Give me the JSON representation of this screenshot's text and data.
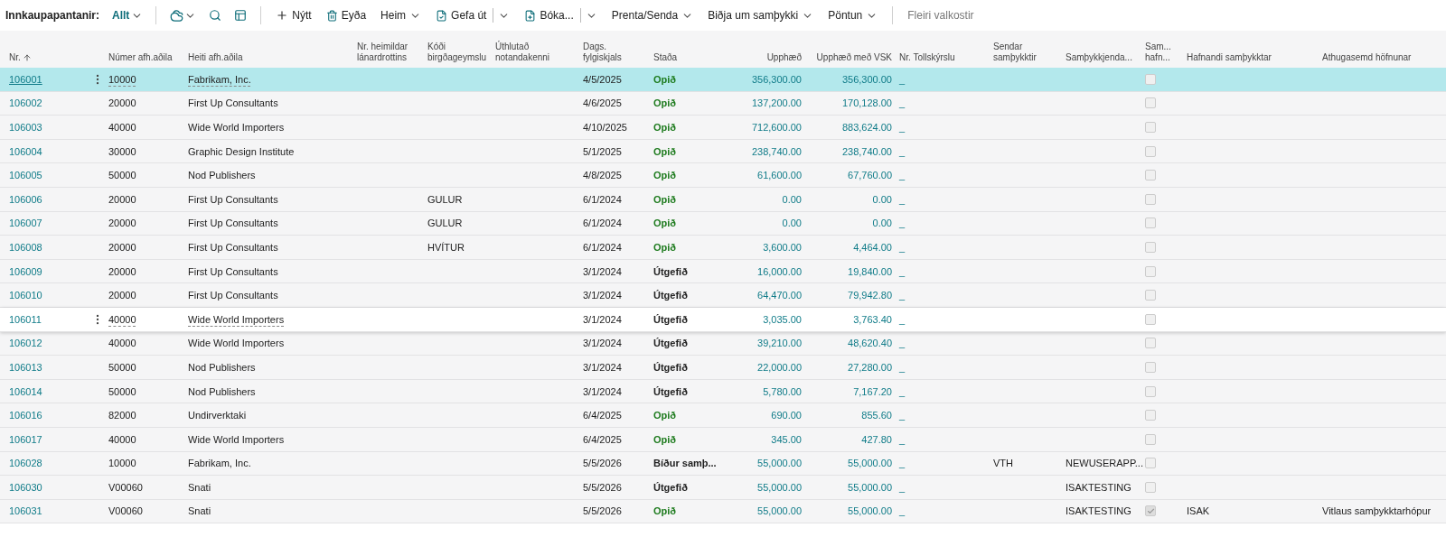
{
  "toolbar": {
    "title": "Innkaupapantanir:",
    "view": {
      "label": "Allt"
    },
    "icon_buttons": [
      {
        "kind": "share",
        "menu": true
      },
      {
        "kind": "search",
        "menu": false
      },
      {
        "kind": "layout",
        "menu": false
      }
    ],
    "actions": [
      {
        "label": "Nýtt",
        "kind": "add"
      },
      {
        "label": "Eyða",
        "kind": "delete"
      },
      {
        "label": "Heim",
        "kind": "menu"
      },
      {
        "label": "Gefa út",
        "kind": "release"
      },
      {
        "label": "Bóka...",
        "kind": "post"
      },
      {
        "label": "Prenta/Senda",
        "kind": "menu"
      },
      {
        "label": "Biðja um samþykki",
        "kind": "menu"
      },
      {
        "label": "Pöntun",
        "kind": "menu"
      }
    ],
    "more": "Fleiri valkostir"
  },
  "table": {
    "columns": [
      {
        "label": "Nr.",
        "sorted_ascending": true
      },
      {
        "label": "Númer afh.aðila"
      },
      {
        "label": "Heiti afh.aðila"
      },
      {
        "label": "Nr. heimildar\nlánardrottins"
      },
      {
        "label": "Kóði\nbirgðageymslu"
      },
      {
        "label": "Úthlutað\nnotandakenni"
      },
      {
        "label": "Dags.\nfylgiskjals"
      },
      {
        "label": "Staða"
      },
      {
        "label": "Upphæð"
      },
      {
        "label": "Upphæð með VSK"
      },
      {
        "label": "Nr. Tollskýrslu"
      },
      {
        "label": "Sendar\nsamþykktir"
      },
      {
        "label": "Samþykkjenda..."
      },
      {
        "label": "Sam...\nhafn..."
      },
      {
        "label": "Hafnandi samþykktar"
      },
      {
        "label": "Athugasemd höfnunar"
      }
    ],
    "rows": [
      {
        "no": "106001",
        "vendor_no": "10000",
        "vendor": "Fabrikam, Inc.",
        "date": "4/5/2025",
        "status": "Opið",
        "color": "#1e7b1e",
        "amount": "356,300.00",
        "amount_vat": "356,300.00",
        "customs": "_",
        "rejected": false,
        "selected": true,
        "focused": false
      },
      {
        "no": "106002",
        "vendor_no": "20000",
        "vendor": "First Up Consultants",
        "date": "4/6/2025",
        "status": "Opið",
        "color": "#1e7b1e",
        "amount": "137,200.00",
        "amount_vat": "170,128.00",
        "customs": "_",
        "rejected": false,
        "selected": false,
        "focused": false
      },
      {
        "no": "106003",
        "vendor_no": "40000",
        "vendor": "Wide World Importers",
        "date": "4/10/2025",
        "status": "Opið",
        "color": "#1e7b1e",
        "amount": "712,600.00",
        "amount_vat": "883,624.00",
        "customs": "_",
        "rejected": false,
        "selected": false,
        "focused": false
      },
      {
        "no": "106004",
        "vendor_no": "30000",
        "vendor": "Graphic Design Institute",
        "date": "5/1/2025",
        "status": "Opið",
        "color": "#1e7b1e",
        "amount": "238,740.00",
        "amount_vat": "238,740.00",
        "customs": "_",
        "rejected": false,
        "selected": false,
        "focused": false
      },
      {
        "no": "106005",
        "vendor_no": "50000",
        "vendor": "Nod Publishers",
        "date": "4/8/2025",
        "status": "Opið",
        "color": "#1e7b1e",
        "amount": "61,600.00",
        "amount_vat": "67,760.00",
        "customs": "_",
        "rejected": false,
        "selected": false,
        "focused": false
      },
      {
        "no": "106006",
        "vendor_no": "20000",
        "vendor": "First Up Consultants",
        "location": "GULUR",
        "date": "6/1/2024",
        "status": "Opið",
        "color": "#1e7b1e",
        "amount": "0.00",
        "amount_vat": "0.00",
        "customs": "_",
        "rejected": false,
        "selected": false,
        "focused": false
      },
      {
        "no": "106007",
        "vendor_no": "20000",
        "vendor": "First Up Consultants",
        "location": "GULUR",
        "date": "6/1/2024",
        "status": "Opið",
        "color": "#1e7b1e",
        "amount": "0.00",
        "amount_vat": "0.00",
        "customs": "_",
        "rejected": false,
        "selected": false,
        "focused": false
      },
      {
        "no": "106008",
        "vendor_no": "20000",
        "vendor": "First Up Consultants",
        "location": "HVÍTUR",
        "date": "6/1/2024",
        "status": "Opið",
        "color": "#1e7b1e",
        "amount": "3,600.00",
        "amount_vat": "4,464.00",
        "customs": "_",
        "rejected": false,
        "selected": false,
        "focused": false
      },
      {
        "no": "106009",
        "vendor_no": "20000",
        "vendor": "First Up Consultants",
        "date": "3/1/2024",
        "status": "Útgefið",
        "color": "#212121",
        "amount": "16,000.00",
        "amount_vat": "19,840.00",
        "customs": "_",
        "rejected": false,
        "selected": false,
        "focused": false
      },
      {
        "no": "106010",
        "vendor_no": "20000",
        "vendor": "First Up Consultants",
        "date": "3/1/2024",
        "status": "Útgefið",
        "color": "#212121",
        "amount": "64,470.00",
        "amount_vat": "79,942.80",
        "customs": "_",
        "rejected": false,
        "selected": false,
        "focused": false
      },
      {
        "no": "106011",
        "vendor_no": "40000",
        "vendor": "Wide World Importers",
        "date": "3/1/2024",
        "status": "Útgefið",
        "color": "#212121",
        "amount": "3,035.00",
        "amount_vat": "3,763.40",
        "customs": "_",
        "rejected": false,
        "selected": false,
        "focused": true
      },
      {
        "no": "106012",
        "vendor_no": "40000",
        "vendor": "Wide World Importers",
        "date": "3/1/2024",
        "status": "Útgefið",
        "color": "#212121",
        "amount": "39,210.00",
        "amount_vat": "48,620.40",
        "customs": "_",
        "rejected": false,
        "selected": false,
        "focused": false
      },
      {
        "no": "106013",
        "vendor_no": "50000",
        "vendor": "Nod Publishers",
        "date": "3/1/2024",
        "status": "Útgefið",
        "color": "#212121",
        "amount": "22,000.00",
        "amount_vat": "27,280.00",
        "customs": "_",
        "rejected": false,
        "selected": false,
        "focused": false
      },
      {
        "no": "106014",
        "vendor_no": "50000",
        "vendor": "Nod Publishers",
        "date": "3/1/2024",
        "status": "Útgefið",
        "color": "#212121",
        "amount": "5,780.00",
        "amount_vat": "7,167.20",
        "customs": "_",
        "rejected": false,
        "selected": false,
        "focused": false
      },
      {
        "no": "106016",
        "vendor_no": "82000",
        "vendor": "Undirverktaki",
        "date": "6/4/2025",
        "status": "Opið",
        "color": "#1e7b1e",
        "amount": "690.00",
        "amount_vat": "855.60",
        "customs": "_",
        "rejected": false,
        "selected": false,
        "focused": false
      },
      {
        "no": "106017",
        "vendor_no": "40000",
        "vendor": "Wide World Importers",
        "date": "6/4/2025",
        "status": "Opið",
        "color": "#1e7b1e",
        "amount": "345.00",
        "amount_vat": "427.80",
        "customs": "_",
        "rejected": false,
        "selected": false,
        "focused": false
      },
      {
        "no": "106028",
        "vendor_no": "10000",
        "vendor": "Fabrikam, Inc.",
        "date": "5/5/2026",
        "status": "Bíður samþ...",
        "color": "#212121",
        "amount": "55,000.00",
        "amount_vat": "55,000.00",
        "customs": "_",
        "sent": "VTH",
        "approver": "NEWUSERAPP...",
        "rejected": false,
        "selected": false,
        "focused": false
      },
      {
        "no": "106030",
        "vendor_no": "V00060",
        "vendor": "Snati",
        "date": "5/5/2026",
        "status": "Útgefið",
        "color": "#212121",
        "amount": "55,000.00",
        "amount_vat": "55,000.00",
        "customs": "_",
        "approver": "ISAKTESTING",
        "rejected": false,
        "selected": false,
        "focused": false
      },
      {
        "no": "106031",
        "vendor_no": "V00060",
        "vendor": "Snati",
        "date": "5/5/2026",
        "status": "Opið",
        "color": "#1e7b1e",
        "amount": "55,000.00",
        "amount_vat": "55,000.00",
        "customs": "_",
        "approver": "ISAKTESTING",
        "rejected": true,
        "rejected_by": "ISAK",
        "rejection_note": "Vitlaus samþykktarhópur",
        "selected": false,
        "focused": false
      }
    ]
  }
}
